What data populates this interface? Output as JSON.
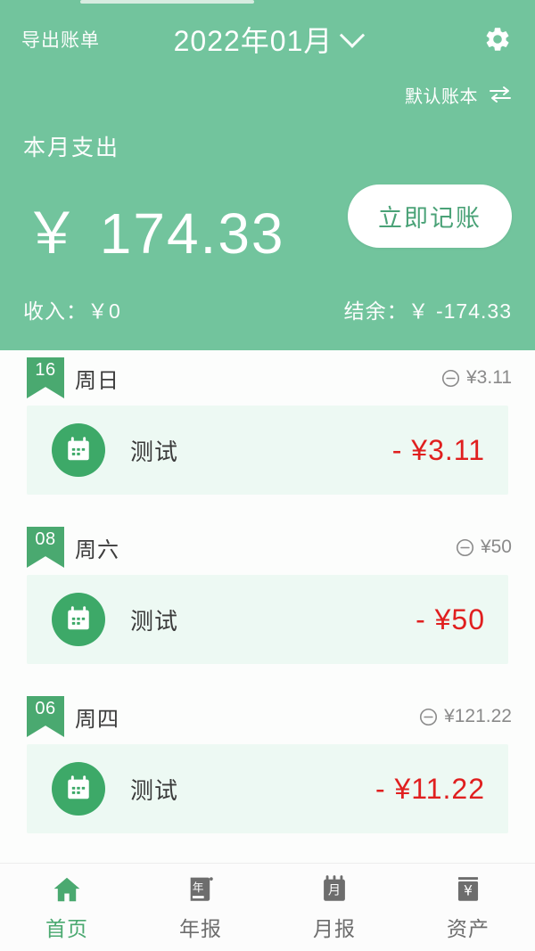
{
  "header": {
    "export_label": "导出账单",
    "month_label": "2022年01月",
    "chevron_icon": "chevron-down-icon",
    "settings_icon": "gear-icon",
    "ledger_name": "默认账本",
    "swap_icon": "swap-icon",
    "expense_title": "本月支出",
    "expense_amount": "￥ 174.33",
    "record_button": "立即记账",
    "income_text": "收入：￥0",
    "balance_text": "结余：￥ -174.33",
    "bg_color": "#72c49d"
  },
  "groups": [
    {
      "day": "16",
      "weekday": "周日",
      "total_icon": "minus-circle-icon",
      "total": "¥3.11",
      "transactions": [
        {
          "icon": "calendar-icon",
          "name": "测试",
          "amount": "- ¥3.11"
        }
      ]
    },
    {
      "day": "08",
      "weekday": "周六",
      "total_icon": "minus-circle-icon",
      "total": "¥50",
      "transactions": [
        {
          "icon": "calendar-icon",
          "name": "测试",
          "amount": "- ¥50"
        }
      ]
    },
    {
      "day": "06",
      "weekday": "周四",
      "total_icon": "minus-circle-icon",
      "total": "¥121.22",
      "transactions": [
        {
          "icon": "calendar-icon",
          "name": "测试",
          "amount": "- ¥11.22"
        }
      ]
    }
  ],
  "tabbar": {
    "items": [
      {
        "label": "首页",
        "icon": "home-icon",
        "active": true
      },
      {
        "label": "年报",
        "icon": "year-report-icon",
        "active": false
      },
      {
        "label": "月报",
        "icon": "month-report-icon",
        "active": false
      },
      {
        "label": "资产",
        "icon": "assets-icon",
        "active": false
      }
    ]
  },
  "colors": {
    "brand_green": "#72c49d",
    "accent_green": "#4aa970",
    "expense_red": "#e01f1f",
    "row_tint": "#edf9f3"
  }
}
